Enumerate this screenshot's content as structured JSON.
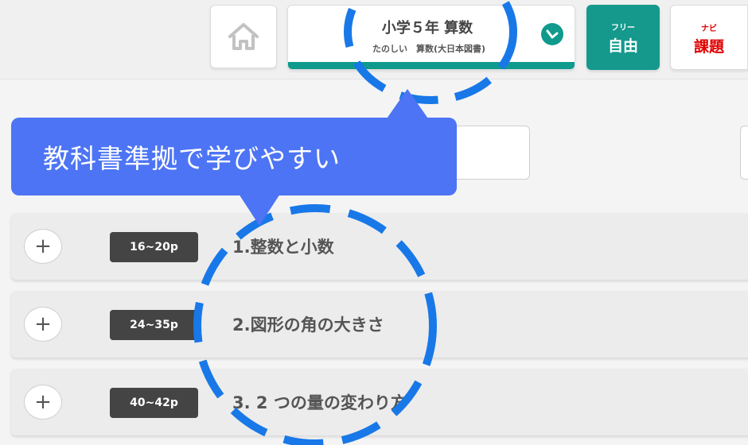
{
  "header": {
    "home_icon": "home-icon",
    "course": {
      "title": "小学５年 算数",
      "subtitle": "たのしい　算数(大日本図書)",
      "check_icon": "check-circle-icon"
    },
    "free_button": {
      "small_label": "フリー",
      "label": "自由"
    },
    "navi_button": {
      "small_label": "ナビ",
      "label": "課題"
    }
  },
  "callout": {
    "text": "教科書準拠で学びやすい"
  },
  "chapters": [
    {
      "pages": "16~20p",
      "title": "1.整数と小数"
    },
    {
      "pages": "24~35p",
      "title": "2.図形の角の大きさ"
    },
    {
      "pages": "40~42p",
      "title": "3. 2 つの量の変わり方"
    }
  ],
  "colors": {
    "accent": "#14998c",
    "navi_red": "#e00000",
    "callout_blue": "#4d74f4",
    "annotation_blue": "#1878e8",
    "badge_dark": "#444444"
  }
}
